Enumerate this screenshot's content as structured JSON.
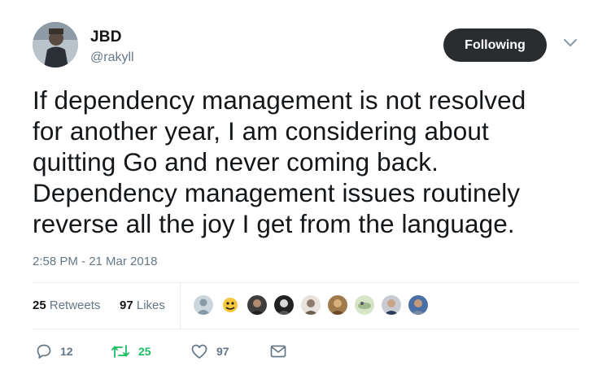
{
  "author": {
    "display_name": "JBD",
    "handle": "@rakyll",
    "avatar": "profile-photo"
  },
  "follow_button": {
    "label": "Following"
  },
  "menu": {
    "icon": "chevron-down-icon"
  },
  "tweet": {
    "lines": [
      "If dependency management is not resolved",
      "for another year, I am considering about",
      "quitting Go and never coming back.",
      "Dependency management issues routinely",
      "reverse all the joy I get from the language."
    ],
    "timestamp": "2:58 PM - 21 Mar 2018"
  },
  "stats": {
    "retweets_count": "25",
    "retweets_label": "Retweets",
    "likes_count": "97",
    "likes_label": "Likes",
    "liker_avatars": [
      "default-avatar",
      "cartoon-avatar",
      "photo-avatar",
      "photo-avatar",
      "photo-avatar",
      "photo-avatar",
      "photo-avatar",
      "photo-avatar",
      "photo-avatar"
    ]
  },
  "actions": {
    "reply": {
      "icon": "reply-icon",
      "count": "12"
    },
    "retweet": {
      "icon": "retweet-icon",
      "count": "25"
    },
    "like": {
      "icon": "heart-icon",
      "count": "97"
    },
    "message": {
      "icon": "envelope-icon"
    }
  },
  "colors": {
    "text": "#14171a",
    "secondary": "#657786",
    "retweet_green": "#17bf63",
    "button_dark": "#2a2d30",
    "divider": "#e6ecf0"
  }
}
